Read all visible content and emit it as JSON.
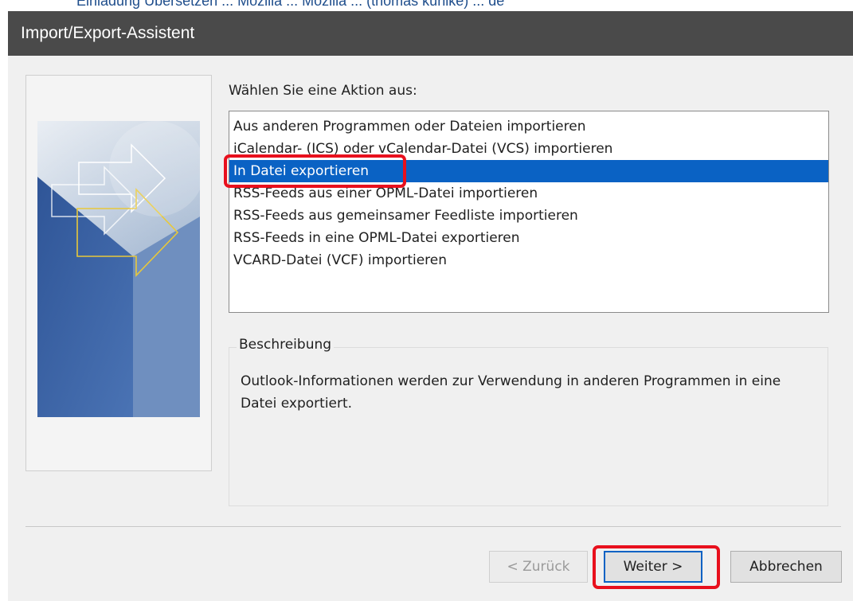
{
  "background_text": "Einladung Ubersetzen ... Mozilla ... Mozilla ... (thomas kuhlke) ... de",
  "window": {
    "title": "Import/Export-Assistent"
  },
  "prompt": "Wählen Sie eine Aktion aus:",
  "actions": [
    {
      "label": "Aus anderen Programmen oder Dateien importieren",
      "selected": false
    },
    {
      "label": "iCalendar- (ICS) oder vCalendar-Datei (VCS) importieren",
      "selected": false
    },
    {
      "label": "In Datei exportieren",
      "selected": true
    },
    {
      "label": "RSS-Feeds aus einer OPML-Datei importieren",
      "selected": false
    },
    {
      "label": "RSS-Feeds aus gemeinsamer Feedliste importieren",
      "selected": false
    },
    {
      "label": "RSS-Feeds in eine OPML-Datei exportieren",
      "selected": false
    },
    {
      "label": "VCARD-Datei (VCF) importieren",
      "selected": false
    }
  ],
  "description": {
    "legend": "Beschreibung",
    "text": "Outlook-Informationen werden zur Verwendung in anderen Programmen in eine Datei exportiert."
  },
  "buttons": {
    "back": "< Zurück",
    "next": "Weiter >",
    "cancel": "Abbrechen"
  },
  "colors": {
    "titlebar": "#4a4a4a",
    "selection": "#0a62c4",
    "highlight": "#e8101d"
  }
}
